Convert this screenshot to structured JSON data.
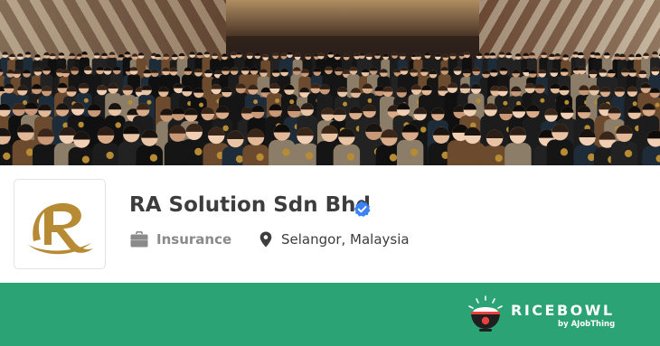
{
  "company": {
    "name": "RA Solution Sdn Bhd",
    "verified": true,
    "industry": "Insurance",
    "location": "Selangor, Malaysia"
  },
  "icons": {
    "verified": "verified-badge-icon",
    "industry": "briefcase-icon",
    "location": "map-pin-icon",
    "logo": "company-logo"
  },
  "footer": {
    "brand": "RICEBOWL",
    "byline": "by AJobThing",
    "brand_color": "#2ba374"
  },
  "colors": {
    "logo_gold": "#b78b34",
    "verified_blue": "#3b82f6",
    "text_dark": "#3d3d3d",
    "text_muted": "#8a8a8a"
  }
}
